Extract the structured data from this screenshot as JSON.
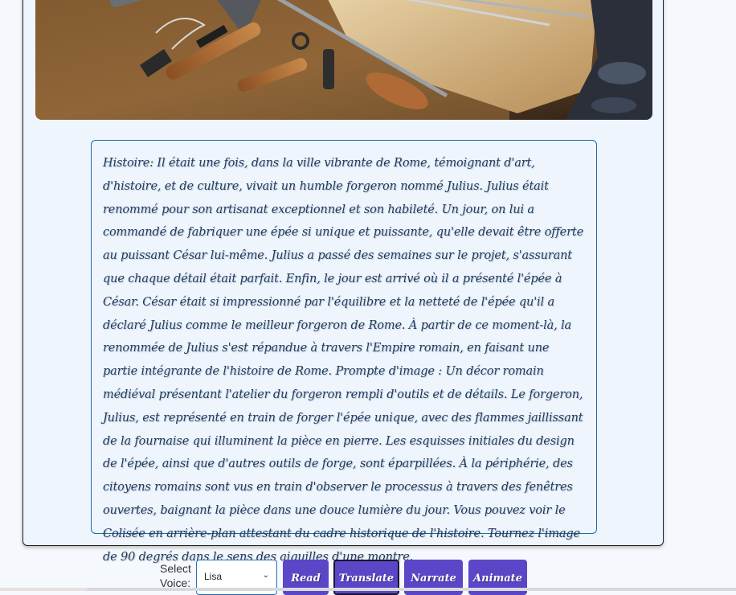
{
  "story": {
    "text": "Histoire: Il était une fois, dans la ville vibrante de Rome, témoignant d'art, d'histoire, et de culture, vivait un humble forgeron nommé Julius. Julius était renommé pour son artisanat exceptionnel et son habileté. Un jour, on lui a commandé de fabriquer une épée si unique et puissante, qu'elle devait être offerte au puissant César lui-même. Julius a passé des semaines sur le projet, s'assurant que chaque détail était parfait. Enfin, le jour est arrivé où il a présenté l'épée à César. César était si impressionné par l'équilibre et la netteté de l'épée qu'il a déclaré Julius comme le meilleur forgeron de Rome. À partir de ce moment-là, la renommée de Julius s'est répandue à travers l'Empire romain, en faisant une partie intégrante de l'histoire de Rome. Prompte d'image : Un décor romain médiéval présentant l'atelier du forgeron rempli d'outils et de détails. Le forgeron, Julius, est représenté en train de forger l'épée unique, avec des flammes jaillissant de la fournaise qui illuminent la pièce en pierre. Les esquisses initiales du design de l'épée, ainsi que d'autres outils de forge, sont éparpillées. À la périphérie, des citoyens romains sont vus en train d'observer le processus à travers des fenêtres ouvertes, baignant la pièce dans une douce lumière du jour. Vous pouvez voir le Colisée en arrière-plan attestant du cadre historique de l'histoire. Tournez l'image de 90 degrés dans le sens des aiguilles d'une montre."
  },
  "controls": {
    "voice_label": "Select Voice:",
    "voice_value": "Lisa",
    "buttons": [
      "Read",
      "Translate",
      "Narrate",
      "Animate"
    ]
  },
  "colors": {
    "button_bg": "#5b46c7",
    "story_border": "#1b6d9a",
    "story_text": "#1f3a5c"
  },
  "icons": {
    "dropdown": "chevron-down-icon"
  }
}
